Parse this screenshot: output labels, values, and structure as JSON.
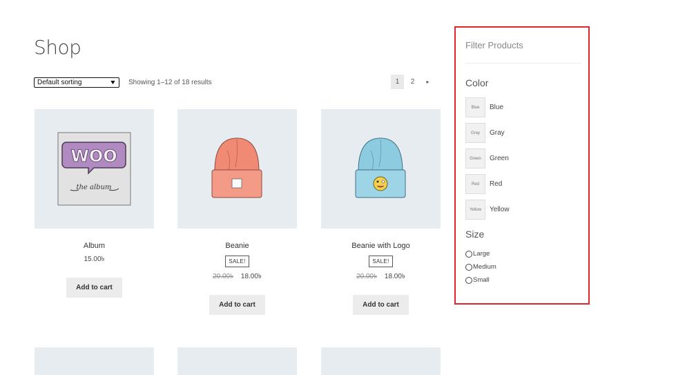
{
  "page": {
    "title": "Shop"
  },
  "toolbar": {
    "sorting_value": "Default sorting",
    "result_count": "Showing 1–12 of 18 results"
  },
  "pagination": {
    "current": "1",
    "next_page": "2",
    "next_icon": "▸"
  },
  "products": [
    {
      "name": "Album",
      "price": "15.00৳",
      "button": "Add to cart"
    },
    {
      "name": "Beanie",
      "sale_badge": "SALE!",
      "old_price": "20.00৳",
      "price": "18.00৳",
      "button": "Add to cart"
    },
    {
      "name": "Beanie with Logo",
      "sale_badge": "SALE!",
      "old_price": "20.00৳",
      "price": "18.00৳",
      "button": "Add to cart"
    }
  ],
  "filter": {
    "title": "Filter Products",
    "color": {
      "title": "Color",
      "options": [
        {
          "swatch": "Blue",
          "label": "Blue"
        },
        {
          "swatch": "Gray",
          "label": "Gray"
        },
        {
          "swatch": "Green",
          "label": "Green"
        },
        {
          "swatch": "Red",
          "label": "Red"
        },
        {
          "swatch": "Yellow",
          "label": "Yellow"
        }
      ]
    },
    "size": {
      "title": "Size",
      "options": [
        "Large",
        "Medium",
        "Small"
      ]
    }
  },
  "colors": {
    "widget_border": "#e0252c",
    "thumb_bg": "#e7ecf0",
    "button_bg": "#ececec"
  }
}
